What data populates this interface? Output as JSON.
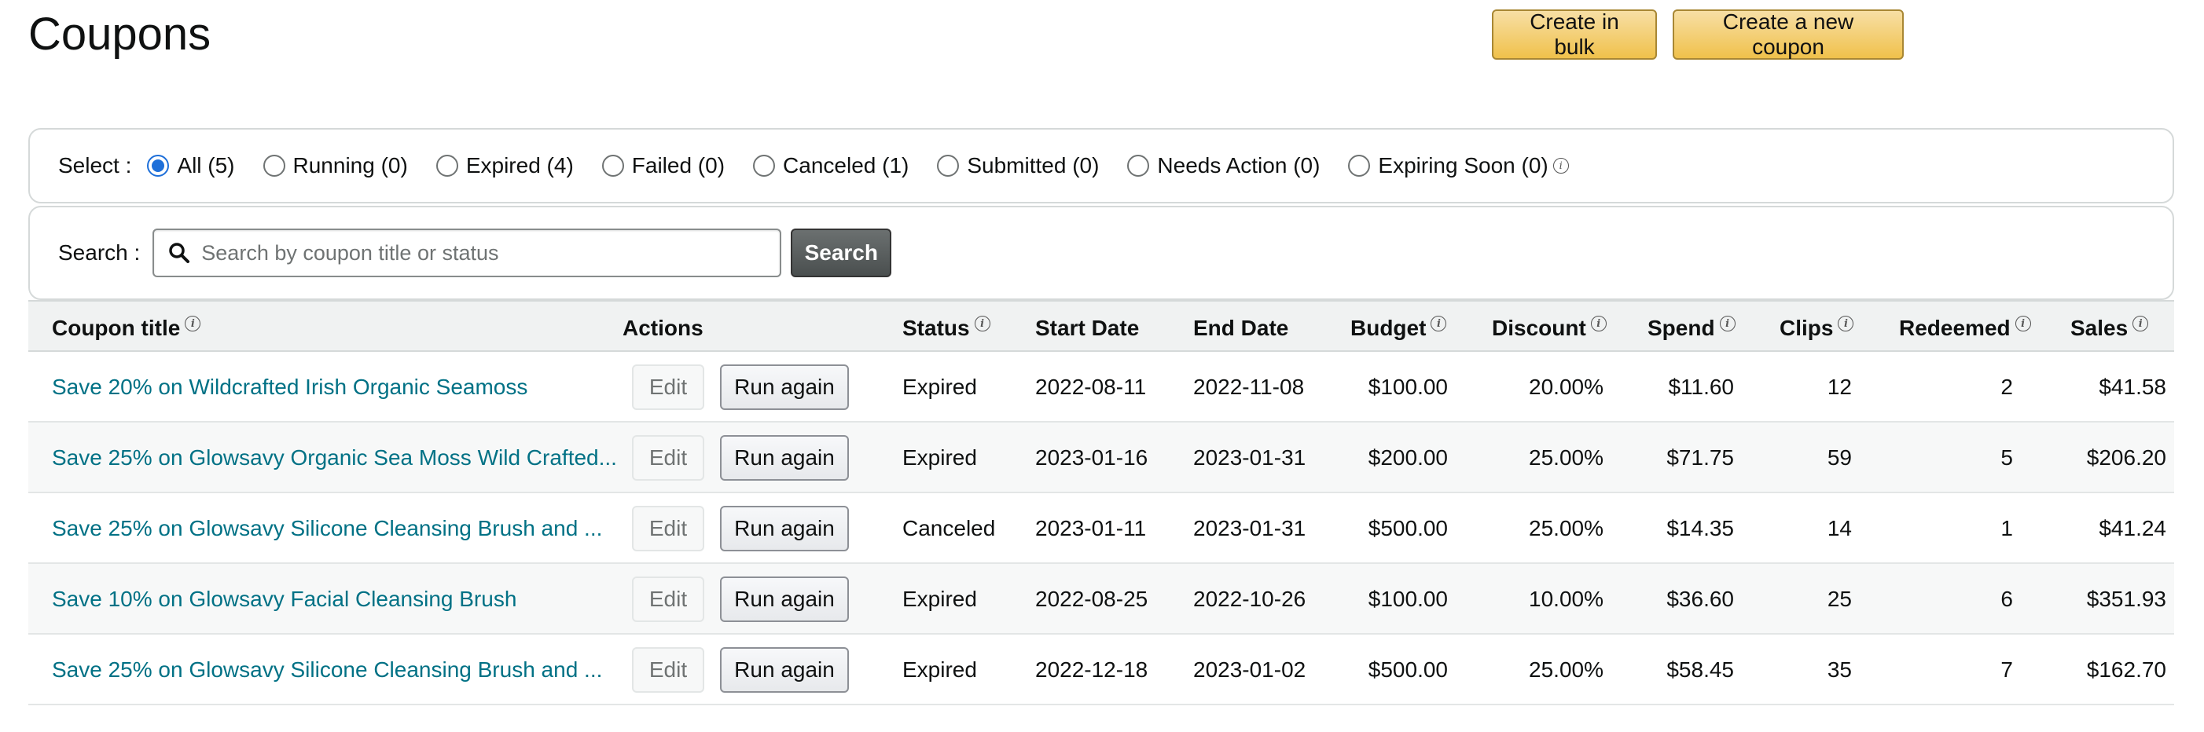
{
  "page": {
    "title": "Coupons"
  },
  "top_actions": {
    "bulk_label": "Create in bulk",
    "new_label": "Create a new coupon"
  },
  "filter": {
    "label": "Select :",
    "options": [
      {
        "label": "All (5)",
        "checked": true
      },
      {
        "label": "Running (0)",
        "checked": false
      },
      {
        "label": "Expired (4)",
        "checked": false
      },
      {
        "label": "Failed (0)",
        "checked": false
      },
      {
        "label": "Canceled (1)",
        "checked": false
      },
      {
        "label": "Submitted (0)",
        "checked": false
      },
      {
        "label": "Needs Action (0)",
        "checked": false
      },
      {
        "label": "Expiring Soon (0)",
        "checked": false
      }
    ]
  },
  "search": {
    "label": "Search :",
    "placeholder": "Search by coupon title or status",
    "button_label": "Search"
  },
  "table": {
    "headers": [
      "Coupon title",
      "Actions",
      "Status",
      "Start Date",
      "End Date",
      "Budget",
      "Discount",
      "Spend",
      "Clips",
      "Redeemed",
      "Sales"
    ],
    "edit_label": "Edit",
    "run_label": "Run again",
    "rows": [
      {
        "title": "Save 20% on Wildcrafted Irish Organic Seamoss",
        "status": "Expired",
        "start": "2022-08-11",
        "end": "2022-11-08",
        "budget": "$100.00",
        "discount": "20.00%",
        "spend": "$11.60",
        "clips": "12",
        "redeemed": "2",
        "sales": "$41.58"
      },
      {
        "title": "Save 25% on Glowsavy Organic Sea Moss Wild Crafted...",
        "status": "Expired",
        "start": "2023-01-16",
        "end": "2023-01-31",
        "budget": "$200.00",
        "discount": "25.00%",
        "spend": "$71.75",
        "clips": "59",
        "redeemed": "5",
        "sales": "$206.20"
      },
      {
        "title": "Save 25% on Glowsavy Silicone Cleansing Brush and ...",
        "status": "Canceled",
        "start": "2023-01-11",
        "end": "2023-01-31",
        "budget": "$500.00",
        "discount": "25.00%",
        "spend": "$14.35",
        "clips": "14",
        "redeemed": "1",
        "sales": "$41.24"
      },
      {
        "title": "Save 10% on Glowsavy Facial Cleansing Brush",
        "status": "Expired",
        "start": "2022-08-25",
        "end": "2022-10-26",
        "budget": "$100.00",
        "discount": "10.00%",
        "spend": "$36.60",
        "clips": "25",
        "redeemed": "6",
        "sales": "$351.93"
      },
      {
        "title": "Save 25% on Glowsavy Silicone Cleansing Brush and ...",
        "status": "Expired",
        "start": "2022-12-18",
        "end": "2023-01-02",
        "budget": "$500.00",
        "discount": "25.00%",
        "spend": "$58.45",
        "clips": "35",
        "redeemed": "7",
        "sales": "$162.70"
      }
    ]
  },
  "colors": {
    "link": "#007185",
    "primary_button": "#f0c14b",
    "radio_checked": "#1e6fd9",
    "search_button": "#4a4f4f"
  },
  "icons": {
    "info": "info-icon",
    "search": "search-icon"
  }
}
